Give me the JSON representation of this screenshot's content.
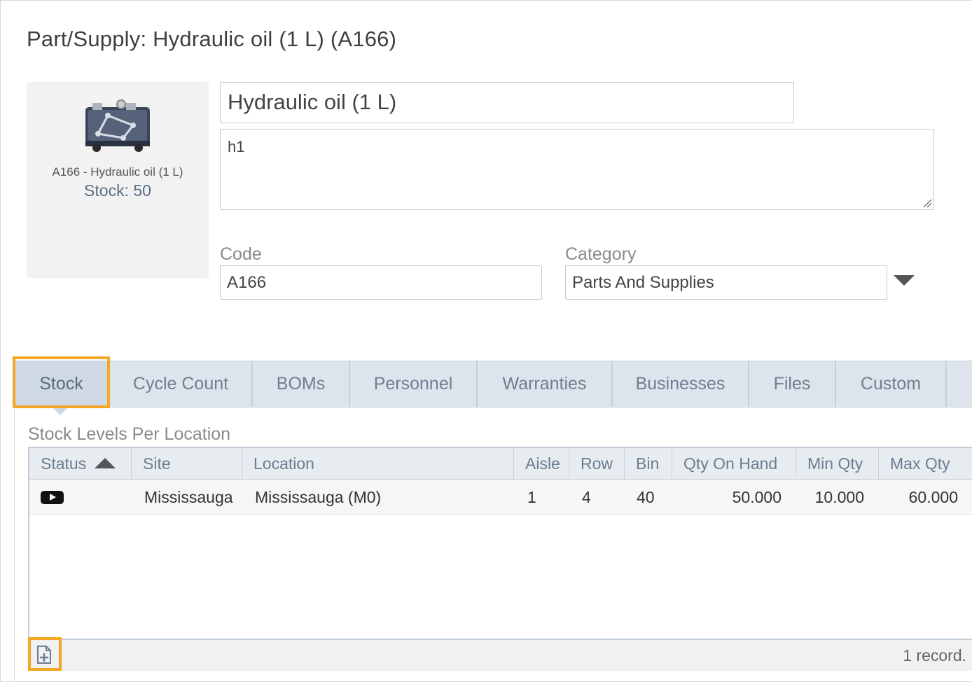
{
  "page": {
    "title": "Part/Supply: Hydraulic oil (1 L) (A166)"
  },
  "thumbnail": {
    "icon": "toolbox-icon",
    "caption": "A166 - Hydraulic oil (1 L)",
    "stock": "Stock: 50"
  },
  "form": {
    "name_value": "Hydraulic oil (1 L)",
    "description_value": "h1",
    "code_label": "Code",
    "code_value": "A166",
    "category_label": "Category",
    "category_value": "Parts And Supplies"
  },
  "tabs": [
    {
      "label": "Stock",
      "active": true
    },
    {
      "label": "Cycle Count"
    },
    {
      "label": "BOMs"
    },
    {
      "label": "Personnel"
    },
    {
      "label": "Warranties"
    },
    {
      "label": "Businesses"
    },
    {
      "label": "Files"
    },
    {
      "label": "Custom"
    }
  ],
  "stock_section": {
    "title": "Stock Levels Per Location",
    "columns": [
      "Status",
      "Site",
      "Location",
      "Aisle",
      "Row",
      "Bin",
      "Qty On Hand",
      "Min Qty",
      "Max Qty"
    ],
    "sort": {
      "column": "Status",
      "direction": "ascending"
    },
    "rows": [
      {
        "status_icon": "play-icon",
        "site": "Mississauga",
        "location": "Mississauga (M0)",
        "aisle": "1",
        "row": "4",
        "bin": "40",
        "qty_on_hand": "50.000",
        "min_qty": "10.000",
        "max_qty": "60.000"
      }
    ],
    "record_count": "1 record."
  },
  "colors": {
    "highlight": "#f5a623",
    "tab_bg": "#dde4ec",
    "tab_text": "#6d7f91"
  }
}
